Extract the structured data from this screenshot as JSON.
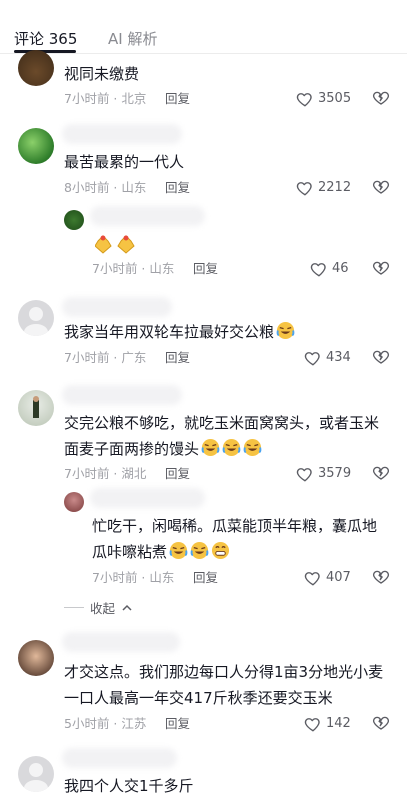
{
  "tabs": {
    "comments_label": "评论 365",
    "ai_label": "AI 解析"
  },
  "comments": [
    {
      "text": "视同未缴费",
      "meta": "7小时前 · 北京",
      "reply": "回复",
      "likes": "3505"
    },
    {
      "text": "最苦最累的一代人",
      "meta": "8小时前 · 山东",
      "reply": "回复",
      "likes": "2212"
    },
    {
      "reply_meta": "7小时前 · 山东",
      "reply": "回复",
      "likes": "46"
    },
    {
      "text": "我家当年用双轮车拉最好交公粮",
      "meta": "7小时前 · 广东",
      "reply": "回复",
      "likes": "434"
    },
    {
      "text_line1": "交完公粮不够吃，就吃玉米面窝窝头，或者玉米",
      "text_line2": "面麦子面两掺的馒头",
      "meta": "7小时前 · 湖北",
      "reply": "回复",
      "likes": "3579"
    },
    {
      "text_line1": "忙吃干，闲喝稀。瓜菜能顶半年粮，囊瓜地",
      "text_line2": "瓜咔嚓粘煮",
      "meta": "7小时前 · 山东",
      "reply": "回复",
      "likes": "407"
    },
    {
      "text_line1": "才交这点。我们那边每口人分得1亩3分地光小麦",
      "text_line2": "一口人最高一年交417斤秋季还要交玉米",
      "meta": "5小时前 · 江苏",
      "reply": "回复",
      "likes": "142"
    },
    {
      "text": "我四个人交1千多斤"
    }
  ],
  "collapse_label": "收起",
  "colors": {
    "text": "#161823",
    "meta": "#a0a1a7",
    "action": "#5b5c63",
    "emoji": "#f6c343"
  }
}
